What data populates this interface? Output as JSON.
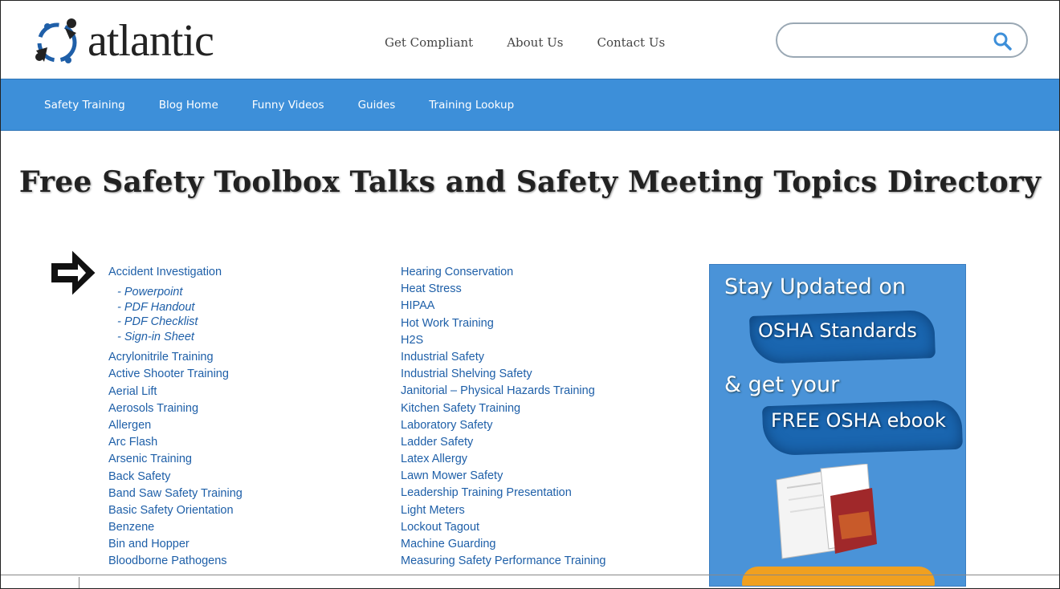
{
  "brand": {
    "name": "atlantic",
    "accent": "#3d8fd9",
    "link_color": "#1e5fa8"
  },
  "topnav": [
    "Get Compliant",
    "About Us",
    "Contact Us"
  ],
  "search": {
    "placeholder": "",
    "value": ""
  },
  "mainnav": [
    "Safety Training",
    "Blog Home",
    "Funny Videos",
    "Guides",
    "Training Lookup"
  ],
  "page_title": "Free Safety Toolbox Talks and Safety Meeting Topics Directory",
  "column1": {
    "first": "Accident Investigation",
    "subs": [
      "- Powerpoint",
      "- PDF Handout",
      "- PDF Checklist",
      "- Sign-in Sheet"
    ],
    "rest": [
      "Acrylonitrile Training",
      "Active Shooter Training",
      "Aerial Lift",
      "Aerosols Training",
      "Allergen",
      "Arc Flash",
      "Arsenic Training",
      "Back Safety",
      "Band Saw Safety Training",
      "Basic Safety Orientation",
      "Benzene",
      "Bin and Hopper",
      "Bloodborne Pathogens"
    ]
  },
  "column2": [
    "Hearing Conservation",
    "Heat Stress",
    "HIPAA",
    "Hot Work Training",
    "H2S",
    "Industrial Safety",
    "Industrial Shelving Safety",
    "Janitorial – Physical Hazards Training",
    "Kitchen Safety Training",
    "Laboratory Safety",
    "Ladder Safety",
    "Latex Allergy",
    "Lawn Mower Safety",
    "Leadership Training Presentation",
    "Light Meters",
    "Lockout Tagout",
    "Machine Guarding",
    "Measuring Safety Performance Training"
  ],
  "ad": {
    "line1": "Stay Updated on",
    "line2": "OSHA Standards",
    "line3": "& get your",
    "line4": "FREE OSHA ebook"
  }
}
